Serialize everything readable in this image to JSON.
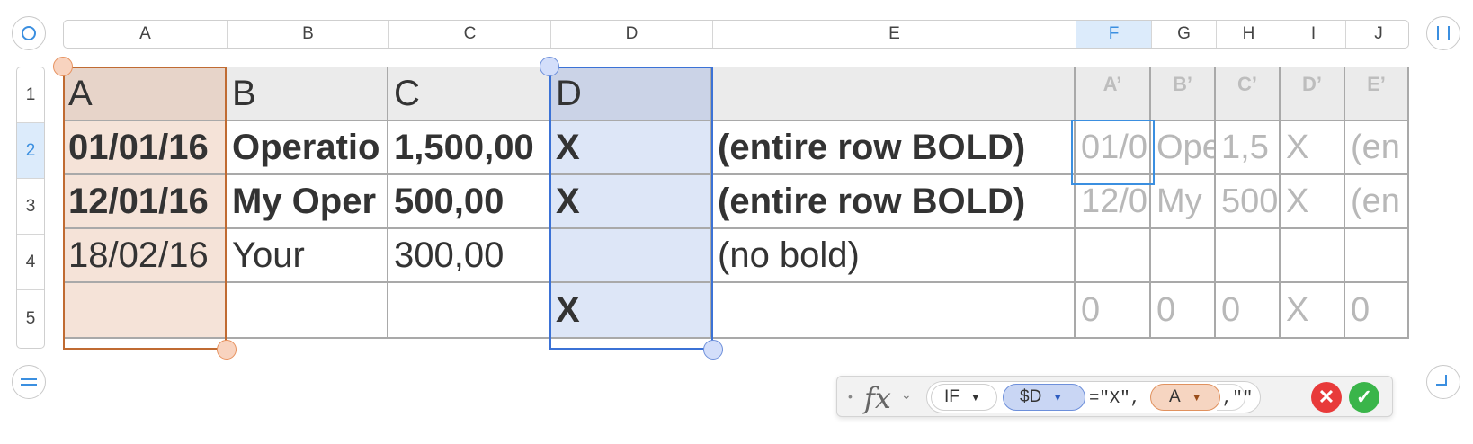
{
  "column_headers": [
    "A",
    "B",
    "C",
    "D",
    "E",
    "F",
    "G",
    "H",
    "I",
    "J"
  ],
  "selected_column": "F",
  "row_headers": [
    "1",
    "2",
    "3",
    "4",
    "5"
  ],
  "selected_row": "2",
  "rows": [
    [
      "A",
      "B",
      "C",
      "D",
      "",
      "A’",
      "B’",
      "C’",
      "D’",
      "E’"
    ],
    [
      "01/01/16",
      "Operatio",
      "1,500,00",
      "X",
      "(entire row BOLD)",
      "01/0",
      "Ope",
      "1,5",
      "X",
      "(en"
    ],
    [
      "12/01/16",
      "My Oper",
      "500,00",
      "X",
      "(entire row BOLD)",
      "12/0",
      "My",
      "500",
      "X",
      "(en"
    ],
    [
      "18/02/16",
      "Your",
      "300,00",
      "",
      "(no bold)",
      "",
      "",
      "",
      "",
      ""
    ],
    [
      "",
      "",
      "",
      "X",
      "",
      "0",
      "0",
      "0",
      "X",
      "0"
    ]
  ],
  "formula_bar": {
    "fx_label": "fx",
    "function_token": "IF",
    "token_d": "$D",
    "literal_1": "=\"X\",",
    "token_a": "A",
    "literal_2": ",\"\"",
    "cancel_symbol": "✕",
    "accept_symbol": "✓"
  },
  "colors": {
    "selection_blue": "#3b8fe0",
    "range_a_border": "#c06b32",
    "range_d_border": "#3b72d6",
    "cancel_red": "#e83a3a",
    "accept_green": "#3ab54a"
  },
  "icons": {
    "top_left": "circle-select-icon",
    "top_right": "freeze-columns-icon",
    "bottom_left": "freeze-rows-icon",
    "bottom_right": "resize-corner-icon"
  }
}
